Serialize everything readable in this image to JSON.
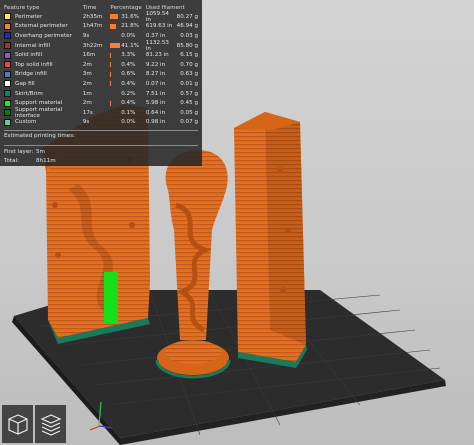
{
  "legend": {
    "headers": [
      "Feature type",
      "Time",
      "Percentage",
      "Used filament"
    ],
    "rows": [
      {
        "name": "Perimeter",
        "color": "#ffe766",
        "time": "2h35m",
        "percent": 31.6,
        "pct_label": "31.6%",
        "length": "1059.54 in",
        "weight": "80.27 g"
      },
      {
        "name": "External perimeter",
        "color": "#ff7d38",
        "time": "1h47m",
        "percent": 21.8,
        "pct_label": "21.8%",
        "length": "619.63 in",
        "weight": "46.94 g"
      },
      {
        "name": "Overhang perimeter",
        "color": "#1f1fff",
        "time": "9s",
        "percent": 0.0,
        "pct_label": "0.0%",
        "length": "0.37 in",
        "weight": "0.03 g"
      },
      {
        "name": "Internal infill",
        "color": "#b03029",
        "time": "3h22m",
        "percent": 41.1,
        "pct_label": "41.1%",
        "length": "1132.53 in",
        "weight": "85.80 g"
      },
      {
        "name": "Solid infill",
        "color": "#9654cc",
        "time": "16m",
        "percent": 3.3,
        "pct_label": "3.3%",
        "length": "81.23 in",
        "weight": "6.15 g"
      },
      {
        "name": "Top solid infill",
        "color": "#f04040",
        "time": "2m",
        "percent": 0.4,
        "pct_label": "0.4%",
        "length": "9.22 in",
        "weight": "0.70 g"
      },
      {
        "name": "Bridge infill",
        "color": "#4d80ba",
        "time": "3m",
        "percent": 0.6,
        "pct_label": "0.6%",
        "length": "8.27 in",
        "weight": "0.63 g"
      },
      {
        "name": "Gap fill",
        "color": "#ffffff",
        "time": "2m",
        "percent": 0.4,
        "pct_label": "0.4%",
        "length": "0.07 in",
        "weight": "0.01 g"
      },
      {
        "name": "Skirt/Brim",
        "color": "#00876e",
        "time": "1m",
        "percent": 0.2,
        "pct_label": "0.2%",
        "length": "7.51 in",
        "weight": "0.57 g"
      },
      {
        "name": "Support material",
        "color": "#00ff00",
        "time": "2m",
        "percent": 0.4,
        "pct_label": "0.4%",
        "length": "5.98 in",
        "weight": "0.45 g"
      },
      {
        "name": "Support material interface",
        "color": "#008000",
        "time": "17s",
        "percent": 0.1,
        "pct_label": "0.1%",
        "length": "0.64 in",
        "weight": "0.05 g"
      },
      {
        "name": "Custom",
        "color": "#5ed194",
        "time": "9s",
        "percent": 0.0,
        "pct_label": "0.0%",
        "length": "0.98 in",
        "weight": "0.07 g"
      }
    ],
    "estimated_title": "Estimated printing times:",
    "first_layer_label": "First layer:",
    "first_layer_value": "5m",
    "total_label": "Total:",
    "total_value": "8h11m"
  },
  "colors": {
    "print_orange": "#e06a1f",
    "bed_dark": "#2f2f2f",
    "skirt_green": "#1a7a5c",
    "support_green": "#18e018",
    "panel_bg": "#282828"
  },
  "icons": [
    "view-cube-icon",
    "layers-icon"
  ]
}
